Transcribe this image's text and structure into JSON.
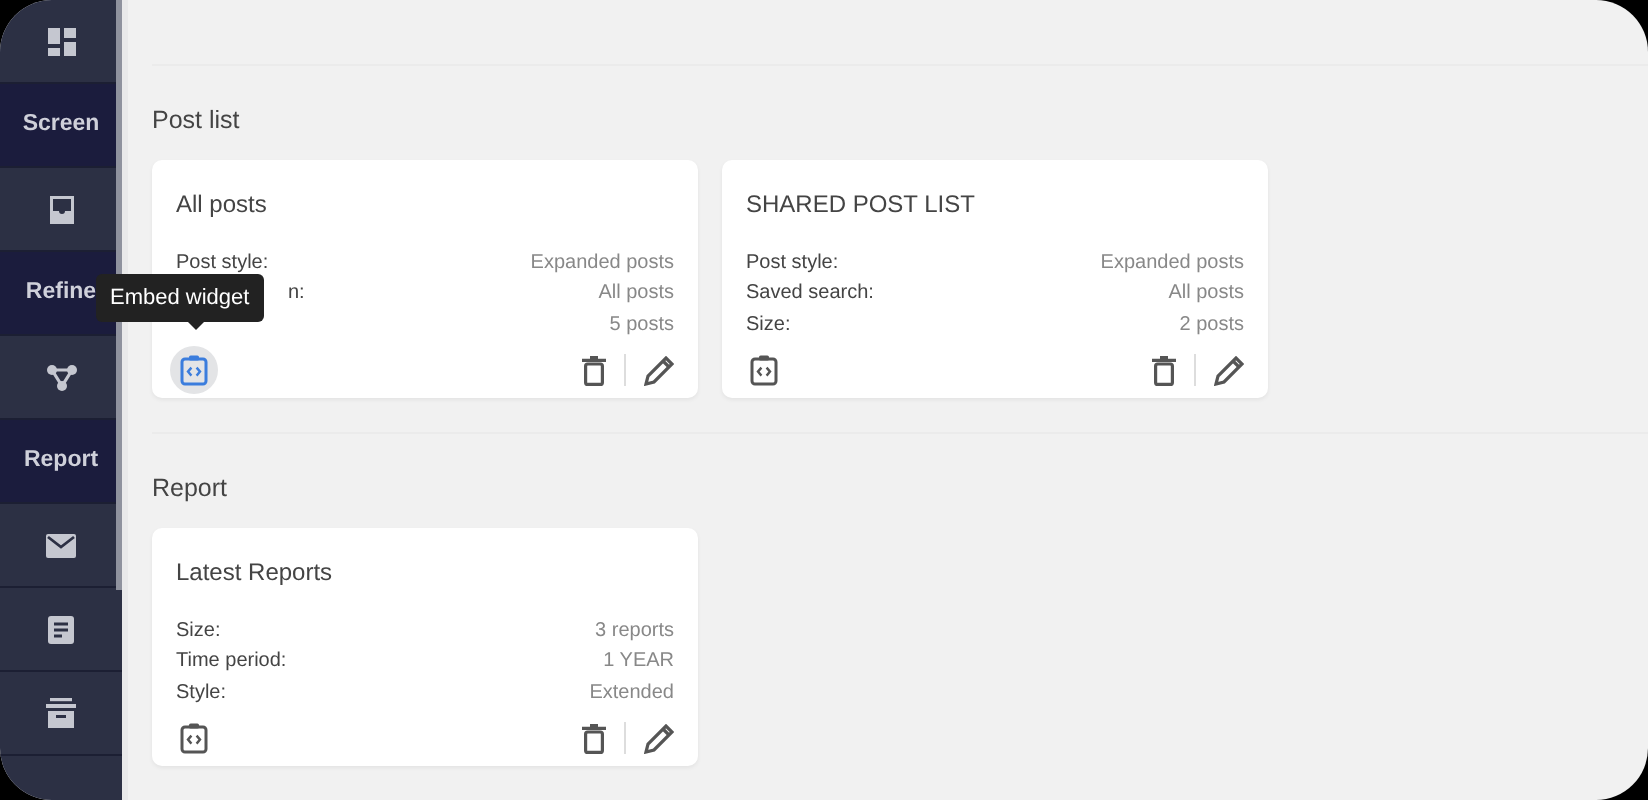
{
  "sidebar": {
    "items": [
      {
        "kind": "icon"
      },
      {
        "kind": "label",
        "text": "Screen"
      },
      {
        "kind": "icon"
      },
      {
        "kind": "label",
        "text": "Refine"
      },
      {
        "kind": "icon"
      },
      {
        "kind": "label",
        "text": "Report"
      },
      {
        "kind": "icon"
      },
      {
        "kind": "icon"
      },
      {
        "kind": "icon"
      }
    ]
  },
  "sections": [
    {
      "title": "Post list",
      "cards": [
        {
          "title": "All posts",
          "embed_highlighted": true,
          "tooltip": "Embed widget",
          "rows": [
            {
              "label": "Post style:",
              "value": "Expanded posts"
            },
            {
              "label": "n:",
              "partly_hidden": true,
              "value": "All posts"
            },
            {
              "value": "5 posts"
            }
          ]
        },
        {
          "title": "SHARED POST LIST",
          "embed_highlighted": false,
          "rows": [
            {
              "label": "Post style:",
              "value": "Expanded posts"
            },
            {
              "label": "Saved search:",
              "value": "All posts"
            },
            {
              "label": "Size:",
              "value": "2 posts"
            }
          ]
        }
      ]
    },
    {
      "title": "Report",
      "cards": [
        {
          "title": "Latest Reports",
          "embed_highlighted": false,
          "rows": [
            {
              "label": "Size:",
              "value": "3 reports"
            },
            {
              "label": "Time period:",
              "value": "1 YEAR"
            },
            {
              "label": "Style:",
              "value": "Extended"
            }
          ]
        }
      ]
    }
  ]
}
